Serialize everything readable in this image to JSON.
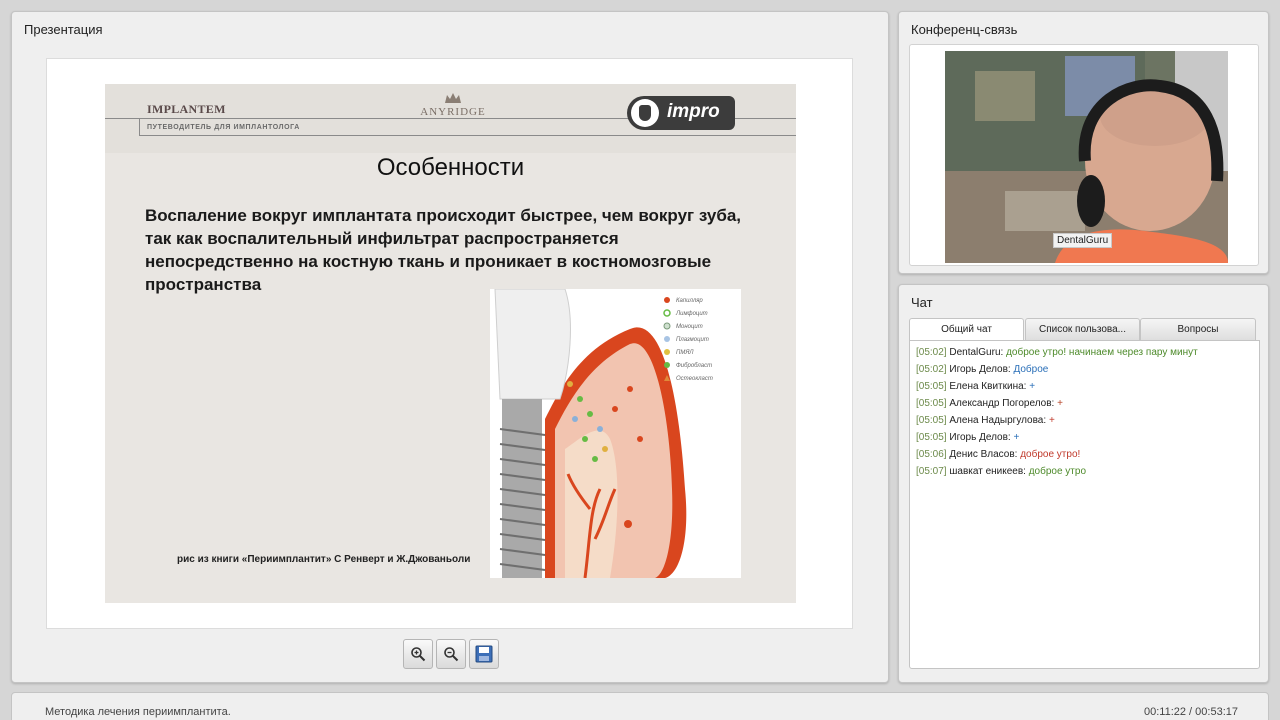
{
  "presentation": {
    "title": "Презентация",
    "slide": {
      "brand": "IMPLANTEM",
      "brand_subtitle": "ПУТЕВОДИТЕЛЬ ДЛЯ ИМПЛАНТОЛОГА",
      "logo_center": "ANYRIDGE",
      "logo_right": "impro",
      "heading": "Особенности",
      "body": "Воспаление вокруг имплантата происходит быстрее, чем вокруг зуба, так как воспалительный инфильтрат распространяется непосредственно на костную ткань и проникает в костномозговые пространства",
      "caption": "рис из книги «Периимплантит» С Ренверт и  Ж.Джованьоли"
    },
    "toolbar": {
      "zoom_in_icon": "zoom-in-icon",
      "zoom_out_icon": "zoom-out-icon",
      "save_icon": "floppy-disk-icon"
    }
  },
  "conference": {
    "title": "Конференц-связь",
    "participant_name": "DentalGuru"
  },
  "chat": {
    "title": "Чат",
    "tabs": [
      "Общий чат",
      "Список пользова...",
      "Вопросы"
    ],
    "messages": [
      {
        "time": "[05:02]",
        "user": "DentalGuru:",
        "text": "доброе утро! начинаем через пару минут",
        "color": "#4d8a2a"
      },
      {
        "time": "[05:02]",
        "user": "Игорь Делов:",
        "text": "Доброе",
        "color": "#2a6fb8"
      },
      {
        "time": "[05:05]",
        "user": "Елена Квиткина:",
        "text": "+",
        "color": "#2a6fb8"
      },
      {
        "time": "[05:05]",
        "user": "Александр Погорелов:",
        "text": "+",
        "color": "#b8452a"
      },
      {
        "time": "[05:05]",
        "user": "Алена Надыргулова:",
        "text": "+",
        "color": "#c0392b"
      },
      {
        "time": "[05:05]",
        "user": "Игорь Делов:",
        "text": "+",
        "color": "#2a6fb8"
      },
      {
        "time": "[05:06]",
        "user": "Денис Власов:",
        "text": "доброе утро!",
        "color": "#c0392b"
      },
      {
        "time": "[05:07]",
        "user": "шавкат еникеев:",
        "text": "доброе утро",
        "color": "#4d8a2a"
      }
    ]
  },
  "footer": {
    "lesson_title": "Методика лечения периимплантита.",
    "time_display": "00:11:22 / 00:53:17"
  }
}
